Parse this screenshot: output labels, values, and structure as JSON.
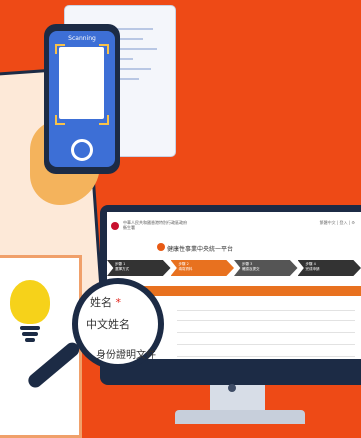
{
  "phone": {
    "scan_label": "Scanning"
  },
  "site": {
    "header_line1": "中華人民共和國香港特別行政區政府",
    "header_line2": "衞生署",
    "portal_title": "健康性事業中央統一平台",
    "top_right": "繁體中文 | 登入 | ⚙"
  },
  "steps": [
    {
      "num": "步驟 1",
      "label": "選擇方式",
      "color": "#333333"
    },
    {
      "num": "步驟 2",
      "label": "填寫資料",
      "color": "#e8711f"
    },
    {
      "num": "步驟 3",
      "label": "確認及提交",
      "color": "#555555"
    },
    {
      "num": "步驟 4",
      "label": "完成申請",
      "color": "#333333"
    }
  ],
  "magnifier": {
    "field1": "姓名",
    "field2": "中文姓名",
    "field3": "身份證明文件"
  },
  "colors": {
    "background": "#ee4a16",
    "accent": "#e8711f",
    "navy": "#1c2b45",
    "bulb": "#f6d21a"
  },
  "icons": [
    "lightbulb-icon",
    "magnifier-icon",
    "camera-shutter-icon",
    "hk-crest-icon"
  ]
}
